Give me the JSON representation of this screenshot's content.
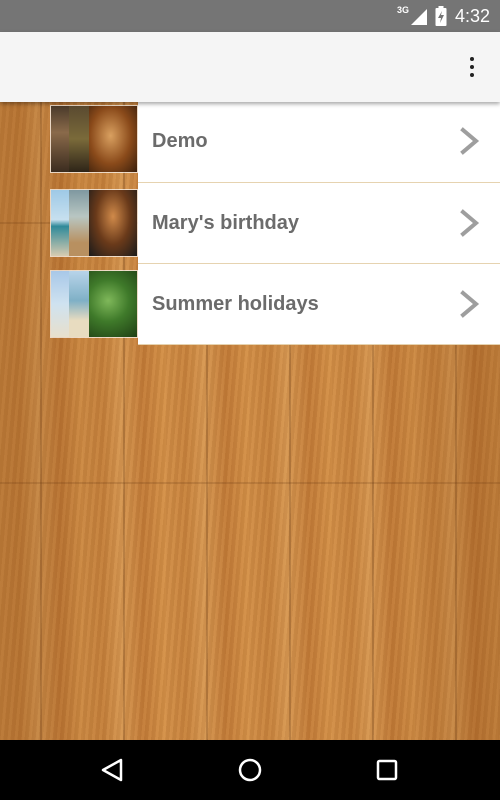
{
  "status_bar": {
    "network_type": "3G",
    "time": "4:32",
    "signal_icon": "cell-signal-icon",
    "battery_icon": "battery-charging-icon"
  },
  "action_bar": {
    "overflow_icon": "overflow-menu-icon"
  },
  "albums": [
    {
      "label": "Demo",
      "chevron_icon": "chevron-right-icon"
    },
    {
      "label": "Mary's birthday",
      "chevron_icon": "chevron-right-icon"
    },
    {
      "label": "Summer holidays",
      "chevron_icon": "chevron-right-icon"
    }
  ],
  "navigation": {
    "back_icon": "back-triangle-icon",
    "home_icon": "home-circle-icon",
    "recents_icon": "recents-square-icon"
  },
  "colors": {
    "status_bar_bg": "#757575",
    "action_bar_bg": "#f5f5f5",
    "card_bg": "#ffffff",
    "label_text": "#6b6b6b",
    "chevron": "#9e9e9e",
    "wood": "#c98a45",
    "nav_bar_bg": "#000000"
  }
}
